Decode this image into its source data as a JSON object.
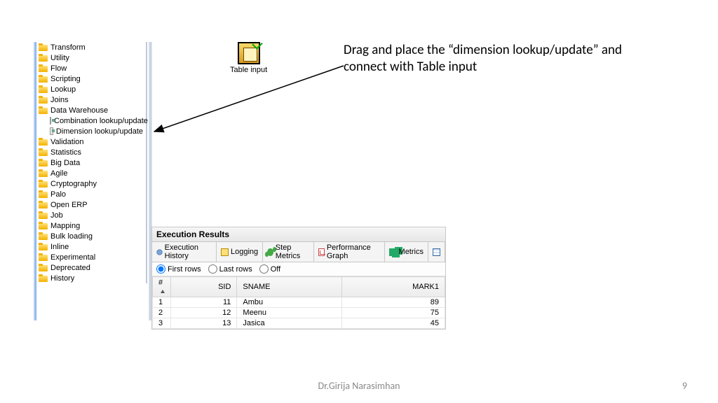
{
  "sidebar": {
    "items": [
      {
        "label": "Transform",
        "type": "folder"
      },
      {
        "label": "Utility",
        "type": "folder"
      },
      {
        "label": "Flow",
        "type": "folder"
      },
      {
        "label": "Scripting",
        "type": "folder"
      },
      {
        "label": "Lookup",
        "type": "folder"
      },
      {
        "label": "Joins",
        "type": "folder"
      },
      {
        "label": "Data Warehouse",
        "type": "folder"
      },
      {
        "label": "Combination lookup/update",
        "type": "step",
        "child": true
      },
      {
        "label": "Dimension lookup/update",
        "type": "step",
        "child": true
      },
      {
        "label": "Validation",
        "type": "folder"
      },
      {
        "label": "Statistics",
        "type": "folder"
      },
      {
        "label": "Big Data",
        "type": "folder"
      },
      {
        "label": "Agile",
        "type": "folder"
      },
      {
        "label": "Cryptography",
        "type": "folder"
      },
      {
        "label": "Palo",
        "type": "folder"
      },
      {
        "label": "Open ERP",
        "type": "folder"
      },
      {
        "label": "Job",
        "type": "folder"
      },
      {
        "label": "Mapping",
        "type": "folder"
      },
      {
        "label": "Bulk loading",
        "type": "folder"
      },
      {
        "label": "Inline",
        "type": "folder"
      },
      {
        "label": "Experimental",
        "type": "folder"
      },
      {
        "label": "Deprecated",
        "type": "folder"
      },
      {
        "label": "History",
        "type": "folder"
      }
    ]
  },
  "canvas": {
    "table_input_label": "Table input"
  },
  "annotation": "Drag and place the “dimension lookup/update” and connect with Table input",
  "exec": {
    "title": "Execution Results",
    "tabs": [
      "Execution History",
      "Logging",
      "Step Metrics",
      "Performance Graph",
      "Metrics"
    ],
    "row_opts": [
      "First rows",
      "Last rows",
      "Off"
    ],
    "row_opt_selected": 0,
    "columns": [
      "#",
      "SID",
      "SNAME",
      "MARK1"
    ],
    "rows": [
      {
        "n": "1",
        "sid": "11",
        "sname": "Ambu",
        "mark": "89"
      },
      {
        "n": "2",
        "sid": "12",
        "sname": "Meenu",
        "mark": "75"
      },
      {
        "n": "3",
        "sid": "13",
        "sname": "Jasica",
        "mark": "45"
      }
    ]
  },
  "footer": {
    "author": "Dr.Girija Narasimhan",
    "page": "9"
  }
}
